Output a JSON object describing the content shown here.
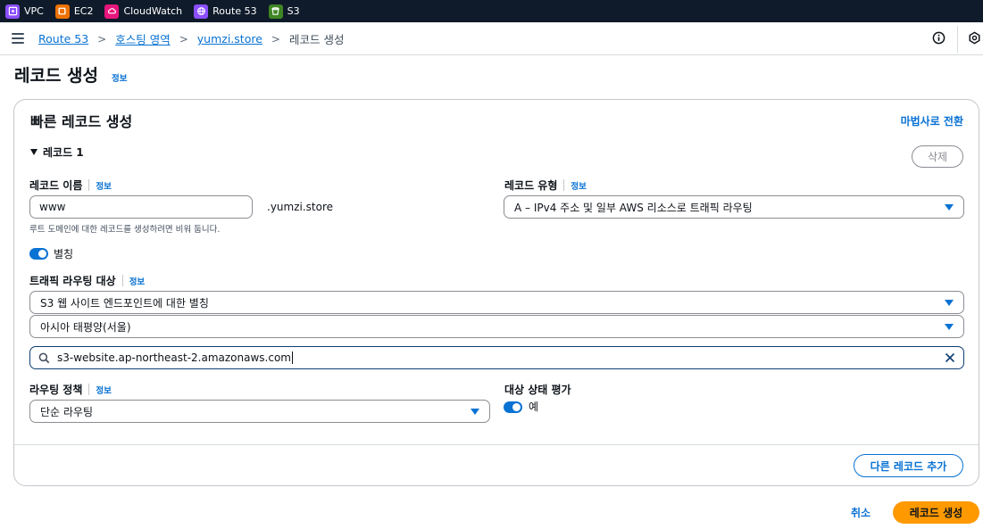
{
  "favorites": [
    {
      "label": "VPC",
      "icon": "vpc-icon",
      "color": "#8c4fff"
    },
    {
      "label": "EC2",
      "icon": "ec2-icon",
      "color": "#ed7100"
    },
    {
      "label": "CloudWatch",
      "icon": "cloudwatch-icon",
      "color": "#e7157b"
    },
    {
      "label": "Route 53",
      "icon": "route53-icon",
      "color": "#8c4fff"
    },
    {
      "label": "S3",
      "icon": "s3-icon",
      "color": "#3f8624"
    }
  ],
  "breadcrumb": {
    "items": [
      "Route 53",
      "호스팅 영역",
      "yumzi.store"
    ],
    "current": "레코드 생성"
  },
  "page": {
    "title": "레코드 생성",
    "info": "정보"
  },
  "form": {
    "section_title": "빠른 레코드 생성",
    "wizard_link": "마법사로 전환",
    "record_header": "레코드 1",
    "delete_label": "삭제",
    "record_name": {
      "label": "레코드 이름",
      "info": "정보",
      "value": "www",
      "suffix": ".yumzi.store",
      "hint": "루트 도메인에 대한 레코드를 생성하려면 비워 둡니다."
    },
    "record_type": {
      "label": "레코드 유형",
      "info": "정보",
      "value": "A – IPv4 주소 및 일부 AWS 리소스로 트래픽 라우팅"
    },
    "alias": {
      "label": "별칭",
      "enabled": true
    },
    "route_target": {
      "label": "트래픽 라우팅 대상",
      "info": "정보",
      "endpoint_type": "S3 웹 사이트 엔드포인트에 대한 별칭",
      "region": "아시아 태평양(서울)",
      "endpoint_value": "s3-website.ap-northeast-2.amazonaws.com"
    },
    "routing_policy": {
      "label": "라우팅 정책",
      "info": "정보",
      "value": "단순 라우팅"
    },
    "health_eval": {
      "label": "대상 상태 평가",
      "toggle_label": "예",
      "enabled": true
    },
    "add_record_label": "다른 레코드 추가"
  },
  "footer": {
    "cancel_label": "취소",
    "create_label": "레코드 생성"
  },
  "colors": {
    "accent": "#0972d3",
    "primary_button": "#ff9900",
    "topbar": "#0f1b2a"
  }
}
